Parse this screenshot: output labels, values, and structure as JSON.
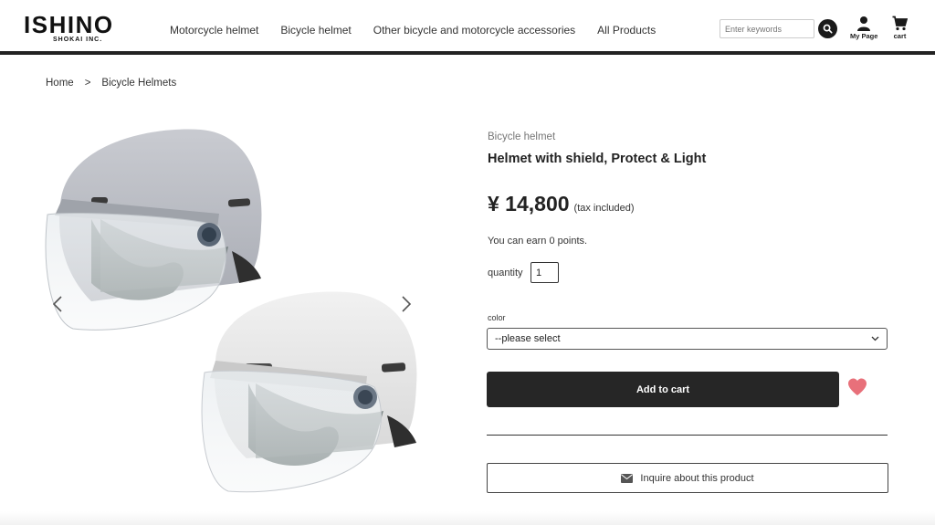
{
  "header": {
    "logo_main": "ISHINO",
    "logo_sub": "SHOKAI INC.",
    "nav": [
      {
        "label": "Motorcycle helmet"
      },
      {
        "label": "Bicycle helmet"
      },
      {
        "label": "Other bicycle and motorcycle accessories"
      },
      {
        "label": "All Products"
      }
    ],
    "search_placeholder": "Enter keywords",
    "mypage_label": "My Page",
    "cart_label": "cart"
  },
  "breadcrumb": {
    "home": "Home",
    "separator": ">",
    "current": "Bicycle Helmets"
  },
  "product": {
    "category": "Bicycle helmet",
    "title": "Helmet with shield, Protect & Light",
    "price": "¥ 14,800",
    "tax_note": "(tax included)",
    "points_text": "You can earn 0 points.",
    "quantity_label": "quantity",
    "quantity_value": "1",
    "color_label": "color",
    "color_selected": "--please select",
    "add_to_cart": "Add to cart",
    "inquire": "Inquire about this product"
  },
  "colors": {
    "header_rule": "#222222",
    "button_dark": "#262626",
    "heart": "#e8707a"
  },
  "icons": [
    "search-icon",
    "user-icon",
    "cart-icon",
    "chevron-left-icon",
    "chevron-right-icon",
    "heart-icon",
    "envelope-icon",
    "chevron-down-icon"
  ]
}
